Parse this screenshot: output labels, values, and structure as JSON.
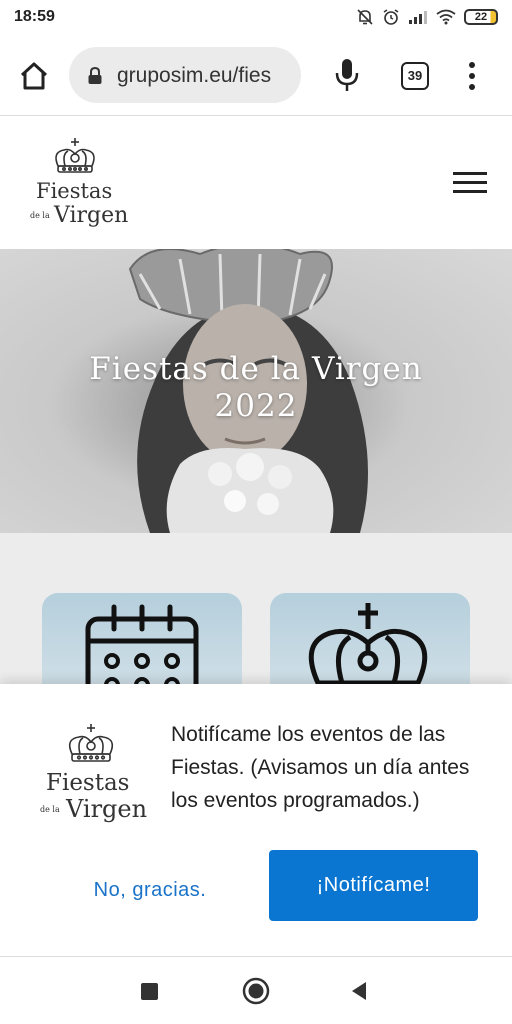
{
  "status_bar": {
    "time": "18:59",
    "battery": "22",
    "icons": [
      "bell-off-icon",
      "alarm-icon",
      "signal-icon",
      "wifi-icon",
      "battery-icon"
    ]
  },
  "browser": {
    "url": "gruposim.eu/fies",
    "tab_count": "39",
    "icons": [
      "home-icon",
      "lock-icon",
      "mic-icon",
      "tabs-icon",
      "overflow-menu-icon"
    ]
  },
  "site": {
    "logo": {
      "line1": "Fiestas",
      "small": "de la",
      "line2": "Virgen"
    },
    "menu_icon": "hamburger-icon"
  },
  "hero": {
    "title_line1": "Fiestas de la Virgen",
    "title_line2": "2022"
  },
  "cards": [
    {
      "icon": "calendar-icon"
    },
    {
      "icon": "crown-icon"
    }
  ],
  "notification_prompt": {
    "message": "Notifícame los eventos de las Fiestas. (Avisamos un día antes los eventos programados.)",
    "decline_label": "No, gracias.",
    "accept_label": "¡Notifícame!",
    "colors": {
      "accent": "#0b76d1",
      "link": "#1a73c8"
    }
  },
  "nav_bar": {
    "icons": [
      "recent-apps-icon",
      "home-circle-icon",
      "back-icon"
    ]
  }
}
